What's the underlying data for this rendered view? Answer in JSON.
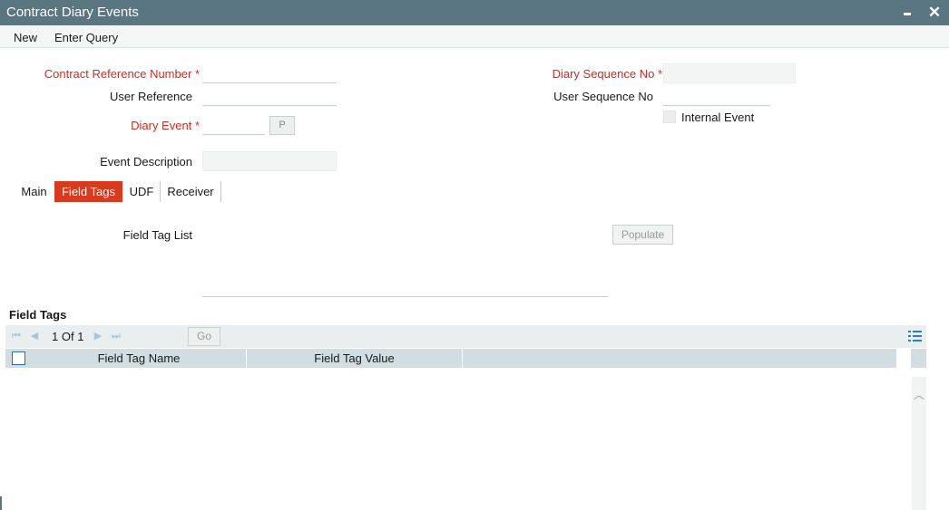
{
  "window": {
    "title": "Contract Diary Events"
  },
  "menu": {
    "new": "New",
    "enter_query": "Enter Query"
  },
  "form": {
    "contract_ref_label": "Contract Reference Number",
    "user_reference_label": "User Reference",
    "diary_event_label": "Diary Event",
    "diary_event_button": "P",
    "event_description_label": "Event Description",
    "diary_sequence_label": "Diary Sequence No",
    "user_sequence_label": "User Sequence No",
    "internal_event_label": "Internal Event",
    "required_mark": "*"
  },
  "tabs": [
    {
      "label": "Main",
      "active": false
    },
    {
      "label": "Field Tags",
      "active": true
    },
    {
      "label": "UDF",
      "active": false
    },
    {
      "label": "Receiver",
      "active": false
    }
  ],
  "field_tags_tab": {
    "field_tag_list_label": "Field Tag List",
    "populate_label": "Populate"
  },
  "grid": {
    "title": "Field Tags",
    "page_current": "1",
    "page_of": "Of",
    "page_total": "1",
    "go_label": "Go",
    "columns": [
      "Field Tag Name",
      "Field Tag Value"
    ],
    "rows": []
  },
  "colors": {
    "titlebar": "#5a7680",
    "active_tab": "#d9391f",
    "required_text": "#d42a1e",
    "grid_header": "#d1dde1"
  },
  "icons": [
    "minimize-icon",
    "close-icon",
    "first-page-icon",
    "prev-page-icon",
    "next-page-icon",
    "last-page-icon",
    "list-settings-icon",
    "scroll-up-icon"
  ]
}
